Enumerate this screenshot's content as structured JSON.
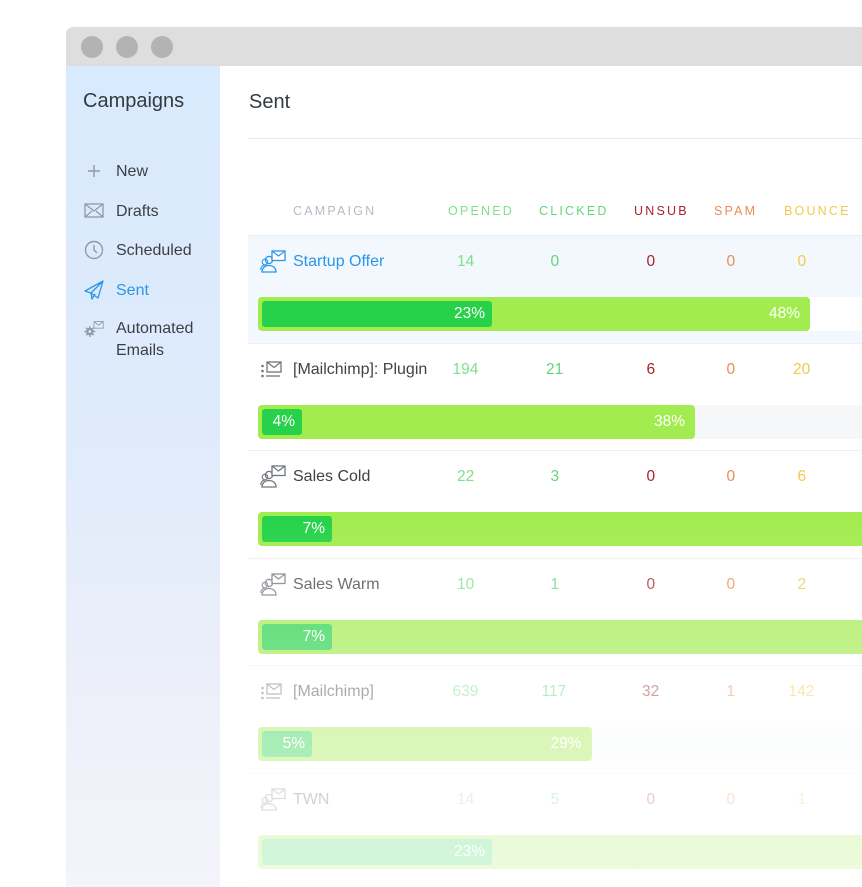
{
  "window": {
    "controls": [
      "close",
      "minimize",
      "maximize"
    ]
  },
  "sidebar": {
    "title": "Campaigns",
    "items": [
      {
        "label": "New",
        "icon": "plus-icon",
        "active": false
      },
      {
        "label": "Drafts",
        "icon": "envelope-icon",
        "active": false
      },
      {
        "label": "Scheduled",
        "icon": "clock-icon",
        "active": false
      },
      {
        "label": "Sent",
        "icon": "paper-plane-icon",
        "active": true
      },
      {
        "label": "Automated Emails",
        "icon": "gear-envelope-icon",
        "active": false
      }
    ]
  },
  "main": {
    "title": "Sent",
    "columns": {
      "campaign": "CAMPAIGN",
      "opened": "OPENED",
      "clicked": "CLICKED",
      "unsub": "UNSUB",
      "spam": "SPAM",
      "bounce": "BOUNCE"
    },
    "colors": {
      "accent": "#2b96e8",
      "opened": "#7ee08a",
      "clicked": "#62d67a",
      "unsub": "#a8232a",
      "spam": "#ec8a55",
      "bounce": "#f2c94c",
      "bar_open": "#a2ec4f",
      "bar_click": "#27d24a"
    },
    "rows": [
      {
        "name": "Startup Offer",
        "icon": "people-envelope-icon",
        "opened": "14",
        "clicked": "0",
        "unsub": "0",
        "spam": "0",
        "bounce": "0",
        "open_rate": 48,
        "open_label": "48%",
        "click_rate": 23,
        "click_label": "23%",
        "highlight": true
      },
      {
        "name": "[Mailchimp]: Plugin",
        "icon": "list-envelope-icon",
        "opened": "194",
        "clicked": "21",
        "unsub": "6",
        "spam": "0",
        "bounce": "20",
        "open_rate": 38,
        "open_label": "38%",
        "click_rate": 4,
        "click_label": "4%",
        "highlight": false
      },
      {
        "name": "Sales Cold",
        "icon": "people-envelope-icon",
        "opened": "22",
        "clicked": "3",
        "unsub": "0",
        "spam": "0",
        "bounce": "6",
        "open_rate": 100,
        "open_label": "",
        "click_rate": 7,
        "click_label": "7%",
        "highlight": false
      },
      {
        "name": "Sales Warm",
        "icon": "people-envelope-icon",
        "opened": "10",
        "clicked": "1",
        "unsub": "0",
        "spam": "0",
        "bounce": "2",
        "open_rate": 100,
        "open_label": "",
        "click_rate": 7,
        "click_label": "7%",
        "highlight": false
      },
      {
        "name": "[Mailchimp]",
        "icon": "list-envelope-icon",
        "opened": "639",
        "clicked": "117",
        "unsub": "32",
        "spam": "1",
        "bounce": "142",
        "open_rate": 29,
        "open_label": "29%",
        "click_rate": 5,
        "click_label": "5%",
        "highlight": false
      },
      {
        "name": "TWN",
        "icon": "people-envelope-icon",
        "opened": "14",
        "clicked": "5",
        "unsub": "0",
        "spam": "0",
        "bounce": "1",
        "open_rate": 100,
        "open_label": "",
        "click_rate": 23,
        "click_label": "23%",
        "highlight": false
      }
    ]
  }
}
